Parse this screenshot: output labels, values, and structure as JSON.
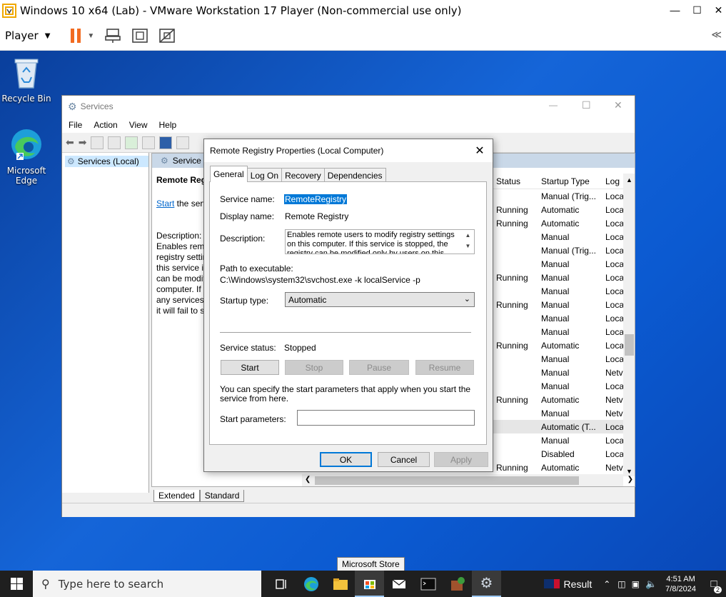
{
  "vm": {
    "title": "Windows 10 x64 (Lab) - VMware Workstation 17 Player (Non-commercial use only)",
    "player_menu": "Player",
    "collapse_label": "≪"
  },
  "desktop": {
    "icons": [
      {
        "label": "Recycle Bin"
      },
      {
        "label": "Microsoft Edge"
      }
    ]
  },
  "services": {
    "title": "Services",
    "menu": [
      "File",
      "Action",
      "View",
      "Help"
    ],
    "tree_item": "Services (Local)",
    "header_strip": "Service",
    "service_heading": "Remote Reg",
    "start_link": "Start",
    "start_link_suffix": " the serv",
    "description_label": "Description:",
    "description_lines": [
      "Enables remo",
      "registry settin",
      "this service is",
      "can be modifi",
      "computer. If",
      "any services t",
      "it will fail to s"
    ],
    "columns": {
      "status": "Status",
      "startup": "Startup Type",
      "logon": "Log"
    },
    "rows": [
      {
        "status": "",
        "startup": "Manual (Trig...",
        "logon": "Loca"
      },
      {
        "status": "Running",
        "startup": "Automatic",
        "logon": "Loca"
      },
      {
        "status": "Running",
        "startup": "Automatic",
        "logon": "Loca"
      },
      {
        "status": "",
        "startup": "Manual",
        "logon": "Loca"
      },
      {
        "status": "",
        "startup": "Manual (Trig...",
        "logon": "Loca"
      },
      {
        "status": "",
        "startup": "Manual",
        "logon": "Loca"
      },
      {
        "status": "Running",
        "startup": "Manual",
        "logon": "Loca"
      },
      {
        "status": "",
        "startup": "Manual",
        "logon": "Loca"
      },
      {
        "status": "Running",
        "startup": "Manual",
        "logon": "Loca"
      },
      {
        "status": "",
        "startup": "Manual",
        "logon": "Loca"
      },
      {
        "status": "",
        "startup": "Manual",
        "logon": "Loca"
      },
      {
        "status": "Running",
        "startup": "Automatic",
        "logon": "Loca"
      },
      {
        "status": "",
        "startup": "Manual",
        "logon": "Loca"
      },
      {
        "status": "",
        "startup": "Manual",
        "logon": "Netv"
      },
      {
        "status": "",
        "startup": "Manual",
        "logon": "Loca"
      },
      {
        "status": "Running",
        "startup": "Automatic",
        "logon": "Netv"
      },
      {
        "status": "",
        "startup": "Manual",
        "logon": "Netv"
      },
      {
        "status": "",
        "startup": "Automatic (T...",
        "logon": "Loca"
      },
      {
        "status": "",
        "startup": "Manual",
        "logon": "Loca"
      },
      {
        "status": "",
        "startup": "Disabled",
        "logon": "Loca"
      },
      {
        "status": "Running",
        "startup": "Automatic",
        "logon": "Netv"
      }
    ],
    "tabs": [
      "Extended",
      "Standard"
    ]
  },
  "dialog": {
    "title": "Remote Registry Properties (Local Computer)",
    "tabs": [
      "General",
      "Log On",
      "Recovery",
      "Dependencies"
    ],
    "service_name_label": "Service name:",
    "service_name_value": "RemoteRegistry",
    "display_name_label": "Display name:",
    "display_name_value": "Remote Registry",
    "description_label": "Description:",
    "description_value": "Enables remote users to modify registry settings on this computer. If this service is stopped, the registry can be modified only by users on this computer. If",
    "path_label": "Path to executable:",
    "path_value": "C:\\Windows\\system32\\svchost.exe -k localService -p",
    "startup_type_label": "Startup type:",
    "startup_type_value": "Automatic",
    "service_status_label": "Service status:",
    "service_status_value": "Stopped",
    "buttons": {
      "start": "Start",
      "stop": "Stop",
      "pause": "Pause",
      "resume": "Resume"
    },
    "params_hint": "You can specify the start parameters that apply when you start the service from here.",
    "start_params_label": "Start parameters:",
    "start_params_value": "",
    "ok": "OK",
    "cancel": "Cancel",
    "apply": "Apply"
  },
  "taskbar": {
    "search_placeholder": "Type here to search",
    "tooltip": "Microsoft Store",
    "result_label": "Result",
    "time": "4:51 AM",
    "date": "7/8/2024",
    "notification_count": "2"
  },
  "colors": {
    "accent": "#0078d7",
    "desktop": "#1565d8",
    "taskbar": "#1f1f1f",
    "pause_orange": "#f26b21"
  }
}
